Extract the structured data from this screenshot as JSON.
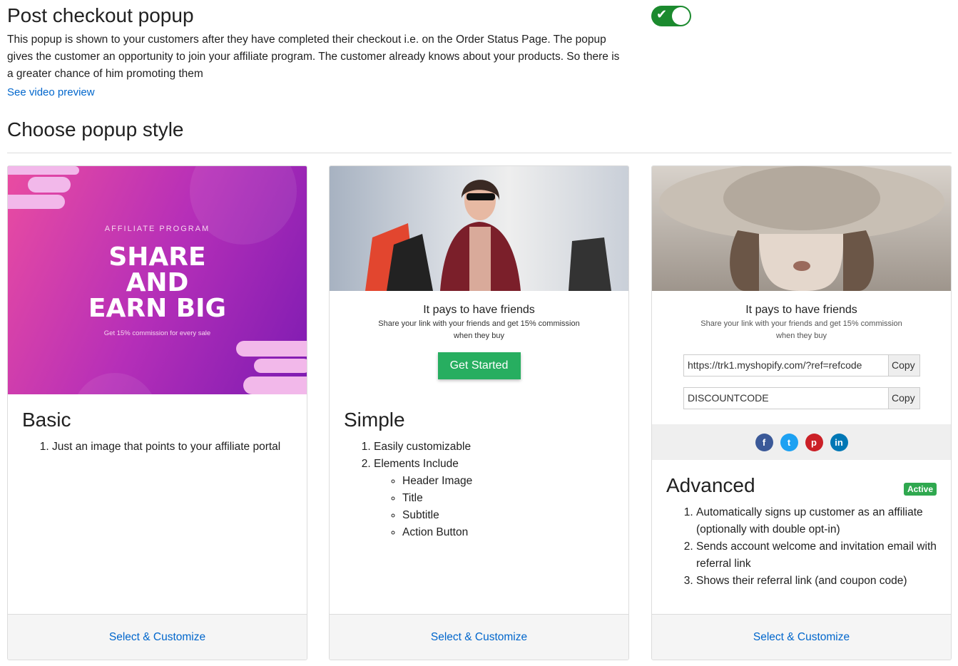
{
  "header": {
    "title": "Post checkout popup",
    "description": "This popup is shown to your customers after they have completed their checkout i.e. on the Order Status Page. The popup gives the customer an opportunity to join your affiliate program. The customer already knows about your products. So there is a greater chance of him promoting them",
    "video_link": "See video preview",
    "toggle_on": true
  },
  "section_title": "Choose popup style",
  "colors": {
    "link": "#0066cc",
    "toggle": "#1b8a2e",
    "badge": "#2fa84f",
    "cta": "#27ae60"
  },
  "cards": [
    {
      "title": "Basic",
      "items": [
        "Just an image that points to your affiliate portal"
      ],
      "footer_link": "Select & Customize",
      "preview": {
        "kicker": "AFFILIATE PROGRAM",
        "headline_1": "SHARE",
        "headline_2": "AND",
        "headline_3": "EARN BIG",
        "sub": "Get 15% commission for every sale"
      }
    },
    {
      "title": "Simple",
      "items": [
        "Easily customizable",
        "Elements Include"
      ],
      "subitems": [
        "Header Image",
        "Title",
        "Subtitle",
        "Action Button"
      ],
      "footer_link": "Select & Customize",
      "preview": {
        "popup_title": "It pays to have friends",
        "popup_sub_1": "Share your link with your friends and get 15% commission",
        "popup_sub_2": "when they buy",
        "button": "Get Started"
      }
    },
    {
      "title": "Advanced",
      "badge": "Active",
      "items": [
        "Automatically signs up customer as an affiliate (optionally with double opt-in)",
        "Sends account welcome and invitation email with referral link",
        "Shows their referral link (and coupon code)"
      ],
      "footer_link": "Select & Customize",
      "preview": {
        "popup_title": "It pays to have friends",
        "popup_sub_1": "Share your link with your friends and get 15% commission",
        "popup_sub_2": "when they buy",
        "link_value": "https://trk1.myshopify.com/?ref=refcode",
        "coupon_value": "DISCOUNTCODE",
        "copy_label": "Copy",
        "social_icons": [
          "facebook-icon",
          "twitter-icon",
          "pinterest-icon",
          "linkedin-icon"
        ]
      }
    }
  ]
}
